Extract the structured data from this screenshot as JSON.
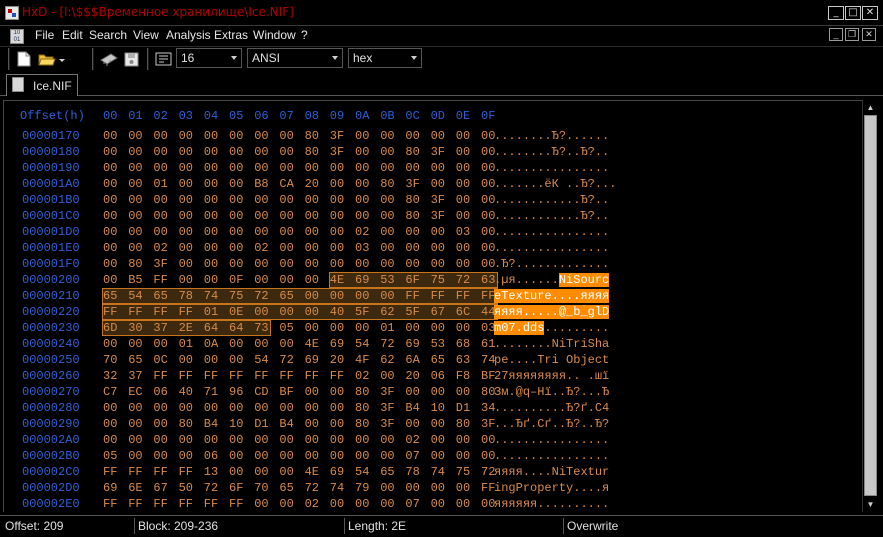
{
  "window": {
    "title": "HxD - [I:\\$$$Временное хранилище\\Ice.NIF]",
    "buttons": {
      "minimize": "_",
      "maximize": "□",
      "close": "✕"
    }
  },
  "menu": {
    "items": [
      "File",
      "Edit",
      "Search",
      "View",
      "Analysis",
      "Extras",
      "Window",
      "?"
    ],
    "mdi_buttons": {
      "minimize": "_",
      "restore": "❐",
      "close": "✕"
    }
  },
  "toolbar": {
    "icons": [
      "new-file-icon",
      "open-folder-icon",
      "dropdown-arrow-icon",
      "ram-chip-icon",
      "disk-icon",
      "bytes-per-row-icon"
    ],
    "bytes_per_row": "16",
    "charset": "ANSI",
    "offset_base": "hex"
  },
  "tab": {
    "label": "Ice.NIF"
  },
  "editor": {
    "header_offset": "Offset(h)",
    "header_columns": [
      "00",
      "01",
      "02",
      "03",
      "04",
      "05",
      "06",
      "07",
      "08",
      "09",
      "0A",
      "0B",
      "0C",
      "0D",
      "0E",
      "0F"
    ],
    "rows": [
      {
        "offset": "00000170",
        "hex": [
          "00",
          "00",
          "00",
          "00",
          "00",
          "00",
          "00",
          "00",
          "80",
          "3F",
          "00",
          "00",
          "00",
          "00",
          "00",
          "00"
        ],
        "text": "........Ђ?......"
      },
      {
        "offset": "00000180",
        "hex": [
          "00",
          "00",
          "00",
          "00",
          "00",
          "00",
          "00",
          "00",
          "80",
          "3F",
          "00",
          "00",
          "80",
          "3F",
          "00",
          "00"
        ],
        "text": "........Ђ?..Ђ?.."
      },
      {
        "offset": "00000190",
        "hex": [
          "00",
          "00",
          "00",
          "00",
          "00",
          "00",
          "00",
          "00",
          "00",
          "00",
          "00",
          "00",
          "00",
          "00",
          "00",
          "00"
        ],
        "text": "................"
      },
      {
        "offset": "000001A0",
        "hex": [
          "00",
          "00",
          "01",
          "00",
          "00",
          "00",
          "B8",
          "CA",
          "20",
          "00",
          "00",
          "80",
          "3F",
          "00",
          "00",
          "00"
        ],
        "text": ".......ёК ..Ђ?..."
      },
      {
        "offset": "000001B0",
        "hex": [
          "00",
          "00",
          "00",
          "00",
          "00",
          "00",
          "00",
          "00",
          "00",
          "00",
          "00",
          "00",
          "80",
          "3F",
          "00",
          "00"
        ],
        "text": "............Ђ?.."
      },
      {
        "offset": "000001C0",
        "hex": [
          "00",
          "00",
          "00",
          "00",
          "00",
          "00",
          "00",
          "00",
          "00",
          "00",
          "00",
          "00",
          "80",
          "3F",
          "00",
          "00"
        ],
        "text": "............Ђ?.."
      },
      {
        "offset": "000001D0",
        "hex": [
          "00",
          "00",
          "00",
          "00",
          "00",
          "00",
          "00",
          "00",
          "00",
          "00",
          "02",
          "00",
          "00",
          "00",
          "03",
          "00"
        ],
        "text": "................"
      },
      {
        "offset": "000001E0",
        "hex": [
          "00",
          "00",
          "02",
          "00",
          "00",
          "00",
          "02",
          "00",
          "00",
          "00",
          "03",
          "00",
          "00",
          "00",
          "00",
          "00"
        ],
        "text": "................"
      },
      {
        "offset": "000001F0",
        "hex": [
          "00",
          "80",
          "3F",
          "00",
          "00",
          "00",
          "00",
          "00",
          "00",
          "00",
          "00",
          "00",
          "00",
          "00",
          "00",
          "00"
        ],
        "text": ".Ђ?............."
      },
      {
        "offset": "00000200",
        "hex": [
          "00",
          "B5",
          "FF",
          "00",
          "00",
          "0F",
          "00",
          "00",
          "00",
          "4E",
          "69",
          "53",
          "6F",
          "75",
          "72",
          "63"
        ],
        "text": ".µя......NiSourc",
        "sel_start": 9,
        "sel_end": 15
      },
      {
        "offset": "00000210",
        "hex": [
          "65",
          "54",
          "65",
          "78",
          "74",
          "75",
          "72",
          "65",
          "00",
          "00",
          "00",
          "00",
          "FF",
          "FF",
          "FF",
          "FF"
        ],
        "text": "eTexture....яяяя",
        "sel_start": 0,
        "sel_end": 15
      },
      {
        "offset": "00000220",
        "hex": [
          "FF",
          "FF",
          "FF",
          "FF",
          "01",
          "0E",
          "00",
          "00",
          "00",
          "40",
          "5F",
          "62",
          "5F",
          "67",
          "6C",
          "44"
        ],
        "text": "яяяя.....@_b_glD",
        "sel_start": 0,
        "sel_end": 15
      },
      {
        "offset": "00000230",
        "hex": [
          "6D",
          "30",
          "37",
          "2E",
          "64",
          "64",
          "73",
          "05",
          "00",
          "00",
          "00",
          "01",
          "00",
          "00",
          "00",
          "03"
        ],
        "text": "m07.dds.........",
        "sel_start": 0,
        "sel_end": 6
      },
      {
        "offset": "00000240",
        "hex": [
          "00",
          "00",
          "00",
          "01",
          "0A",
          "00",
          "00",
          "00",
          "4E",
          "69",
          "54",
          "72",
          "69",
          "53",
          "68",
          "61"
        ],
        "text": "........NiTriSha"
      },
      {
        "offset": "00000250",
        "hex": [
          "70",
          "65",
          "0C",
          "00",
          "00",
          "00",
          "54",
          "72",
          "69",
          "20",
          "4F",
          "62",
          "6A",
          "65",
          "63",
          "74"
        ],
        "text": "pe....Tri Object"
      },
      {
        "offset": "00000260",
        "hex": [
          "32",
          "37",
          "FF",
          "FF",
          "FF",
          "FF",
          "FF",
          "FF",
          "FF",
          "FF",
          "02",
          "00",
          "20",
          "06",
          "F8",
          "BF"
        ],
        "text": "27яяяяяяяя.. .шї"
      },
      {
        "offset": "00000270",
        "hex": [
          "C7",
          "EC",
          "06",
          "40",
          "71",
          "96",
          "CD",
          "BF",
          "00",
          "00",
          "80",
          "3F",
          "00",
          "00",
          "00",
          "80"
        ],
        "text": "Зм.@q–Нї..Ђ?...Ђ"
      },
      {
        "offset": "00000280",
        "hex": [
          "00",
          "00",
          "00",
          "00",
          "00",
          "00",
          "00",
          "00",
          "00",
          "00",
          "80",
          "3F",
          "B4",
          "10",
          "D1",
          "34"
        ],
        "text": "..........Ђ?ґ.С4"
      },
      {
        "offset": "00000290",
        "hex": [
          "00",
          "00",
          "00",
          "80",
          "B4",
          "10",
          "D1",
          "B4",
          "00",
          "00",
          "80",
          "3F",
          "00",
          "00",
          "80",
          "3F"
        ],
        "text": "...Ђґ.Сґ..Ђ?..Ђ?"
      },
      {
        "offset": "000002A0",
        "hex": [
          "00",
          "00",
          "00",
          "00",
          "00",
          "00",
          "00",
          "00",
          "00",
          "00",
          "00",
          "00",
          "02",
          "00",
          "00",
          "00"
        ],
        "text": "................"
      },
      {
        "offset": "000002B0",
        "hex": [
          "05",
          "00",
          "00",
          "00",
          "06",
          "00",
          "00",
          "00",
          "00",
          "00",
          "00",
          "00",
          "07",
          "00",
          "00",
          "00"
        ],
        "text": "................"
      },
      {
        "offset": "000002C0",
        "hex": [
          "FF",
          "FF",
          "FF",
          "FF",
          "13",
          "00",
          "00",
          "00",
          "4E",
          "69",
          "54",
          "65",
          "78",
          "74",
          "75",
          "72"
        ],
        "text": "яяяя....NiTextur"
      },
      {
        "offset": "000002D0",
        "hex": [
          "69",
          "6E",
          "67",
          "50",
          "72",
          "6F",
          "70",
          "65",
          "72",
          "74",
          "79",
          "00",
          "00",
          "00",
          "00",
          "FF"
        ],
        "text": "ingProperty....я"
      },
      {
        "offset": "000002E0",
        "hex": [
          "FF",
          "FF",
          "FF",
          "FF",
          "FF",
          "FF",
          "00",
          "00",
          "02",
          "00",
          "00",
          "00",
          "07",
          "00",
          "00",
          "00"
        ],
        "text": "яяяяяя.........."
      }
    ]
  },
  "status": {
    "offset": "Offset: 209",
    "block": "Block: 209-236",
    "length": "Length: 2E",
    "mode": "Overwrite"
  },
  "colors": {
    "offset_text": "#2f5fd8",
    "hex_text": "#d98a4a",
    "selection": "#ff8c00",
    "title_text": "#b00000"
  }
}
